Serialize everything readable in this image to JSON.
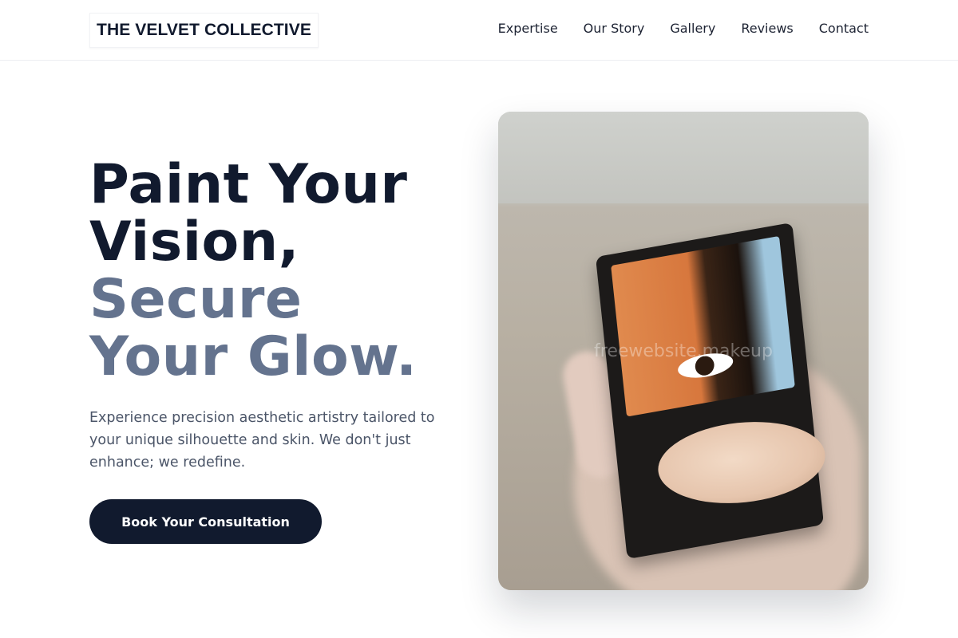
{
  "brand": {
    "name": "THE VELVET COLLECTIVE"
  },
  "nav": {
    "items": [
      "Expertise",
      "Our Story",
      "Gallery",
      "Reviews",
      "Contact"
    ]
  },
  "hero": {
    "line1": "Paint Your",
    "line2": "Vision,",
    "line3": "Secure",
    "line4": "Your Glow.",
    "subtext": "Experience precision aesthetic artistry tailored to your unique silhouette and skin. We don't just enhance; we redefine.",
    "cta_label": "Book Your Consultation"
  },
  "image": {
    "watermark": "freewebsite.makeup"
  },
  "colors": {
    "primary": "#111a2e",
    "muted_heading": "#64738e",
    "body_text": "#4b5568"
  }
}
